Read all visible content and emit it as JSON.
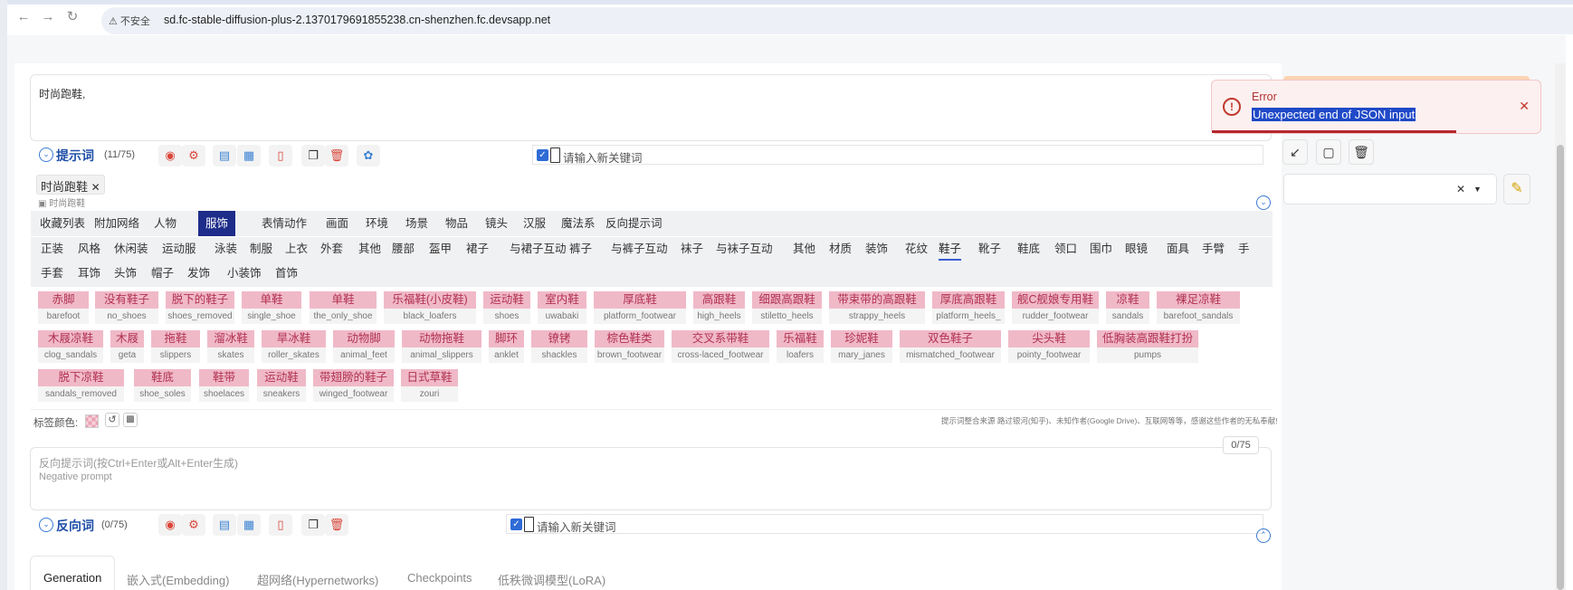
{
  "browser": {
    "insecure_label": "不安全",
    "url": "sd.fc-stable-diffusion-plus-2.1370179691855238.cn-shenzhen.fc.devsapp.net"
  },
  "prompt": {
    "text": "时尚跑鞋,",
    "header_label": "提示词",
    "count": "(11/75)",
    "keyword_placeholder": "请输入新关键词",
    "tag_chip": "时尚跑鞋",
    "tag_chip_hint": "时尚跑鞋"
  },
  "category_tabs": [
    "收藏列表",
    "附加网络",
    "人物",
    "服饰",
    "表情动作",
    "画面",
    "环境",
    "场景",
    "物品",
    "镜头",
    "汉服",
    "魔法系",
    "反向提示词"
  ],
  "active_category": "服饰",
  "sub_tabs_row1": [
    "正装",
    "风格",
    "休闲装",
    "运动服",
    "泳装",
    "制服",
    "上衣",
    "外套",
    "其他",
    "腰部",
    "盔甲",
    "裙子",
    "与裙子互动",
    "裤子",
    "与裤子互动",
    "袜子",
    "与袜子互动",
    "其他",
    "材质",
    "装饰",
    "花纹",
    "鞋子",
    "靴子",
    "鞋底",
    "领口",
    "围巾",
    "眼镜",
    "面具",
    "手臂",
    "手"
  ],
  "sub_tabs_row2": [
    "手套",
    "耳饰",
    "头饰",
    "帽子",
    "发饰",
    "小装饰",
    "首饰"
  ],
  "active_sub_tab": "鞋子",
  "chips_row1": [
    {
      "cn": "赤脚",
      "en": "barefoot"
    },
    {
      "cn": "没有鞋子",
      "en": "no_shoes"
    },
    {
      "cn": "脱下的鞋子",
      "en": "shoes_removed"
    },
    {
      "cn": "单鞋",
      "en": "single_shoe"
    },
    {
      "cn": "单鞋",
      "en": "the_only_shoe"
    },
    {
      "cn": "乐福鞋(小皮鞋)",
      "en": "black_loafers"
    },
    {
      "cn": "运动鞋",
      "en": "shoes"
    },
    {
      "cn": "室内鞋",
      "en": "uwabaki"
    },
    {
      "cn": "厚底鞋",
      "en": "platform_footwear"
    },
    {
      "cn": "高跟鞋",
      "en": "high_heels"
    },
    {
      "cn": "细跟高跟鞋",
      "en": "stiletto_heels"
    },
    {
      "cn": "带束带的高跟鞋",
      "en": "strappy_heels"
    },
    {
      "cn": "厚底高跟鞋",
      "en": "platform_heels_"
    },
    {
      "cn": "舰C舰娘专用鞋",
      "en": "rudder_footwear"
    },
    {
      "cn": "凉鞋",
      "en": "sandals"
    },
    {
      "cn": "裸足凉鞋",
      "en": "barefoot_sandals"
    }
  ],
  "chips_row2": [
    {
      "cn": "木屐凉鞋",
      "en": "clog_sandals"
    },
    {
      "cn": "木屐",
      "en": "geta"
    },
    {
      "cn": "拖鞋",
      "en": "slippers"
    },
    {
      "cn": "溜冰鞋",
      "en": "skates"
    },
    {
      "cn": "旱冰鞋",
      "en": "roller_skates"
    },
    {
      "cn": "动物脚",
      "en": "animal_feet"
    },
    {
      "cn": "动物拖鞋",
      "en": "animal_slippers"
    },
    {
      "cn": "脚环",
      "en": "anklet"
    },
    {
      "cn": "镣铐",
      "en": "shackles"
    },
    {
      "cn": "棕色鞋类",
      "en": "brown_footwear"
    },
    {
      "cn": "交叉系带鞋",
      "en": "cross-laced_footwear"
    },
    {
      "cn": "乐福鞋",
      "en": "loafers"
    },
    {
      "cn": "珍妮鞋",
      "en": "mary_janes"
    },
    {
      "cn": "双色鞋子",
      "en": "mismatched_footwear"
    },
    {
      "cn": "尖头鞋",
      "en": "pointy_footwear"
    },
    {
      "cn": "低胸装高跟鞋打扮",
      "en": "pumps"
    }
  ],
  "chips_row3": [
    {
      "cn": "脱下凉鞋",
      "en": "sandals_removed"
    },
    {
      "cn": "鞋底",
      "en": "shoe_soles"
    },
    {
      "cn": "鞋带",
      "en": "shoelaces"
    },
    {
      "cn": "运动鞋",
      "en": "sneakers"
    },
    {
      "cn": "带翅膀的鞋子",
      "en": "winged_footwear"
    },
    {
      "cn": "日式草鞋",
      "en": "zouri"
    }
  ],
  "tag_color_label": "标签颜色:",
  "credit_text": "提示词整合来源 路过银河(知乎)、未知作者(Google Drive)、互联网等等，感谢这些作者的无私奉献!",
  "negative": {
    "counter": "0/75",
    "placeholder": "反向提示词(按Ctrl+Enter或Alt+Enter生成)",
    "placeholder_en": "Negative prompt",
    "header_label": "反向词",
    "count": "(0/75)",
    "keyword_placeholder": "请输入新关键词"
  },
  "bottom_tabs": [
    "Generation",
    "嵌入式(Embedding)",
    "超网络(Hypernetworks)",
    "Checkpoints",
    "低秩微调模型(LoRA)"
  ],
  "toast": {
    "title": "Error",
    "message": "Unexpected end of JSON input"
  },
  "colors": {
    "accent": "#1e2c8a",
    "chip_bg": "#f0b9c8",
    "error": "#b03030"
  }
}
